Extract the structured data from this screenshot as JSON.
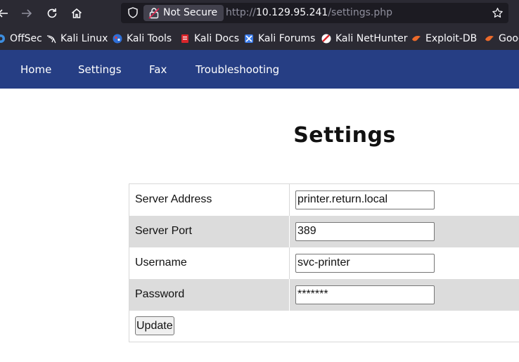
{
  "browser": {
    "not_secure_label": "Not Secure",
    "url_scheme": "http://",
    "url_host": "10.129.95.241",
    "url_path": "/settings.php",
    "bookmarks": [
      {
        "label": "OffSec",
        "icon": "offsec-icon"
      },
      {
        "label": "Kali Linux",
        "icon": "kali-dragon-icon"
      },
      {
        "label": "Kali Tools",
        "icon": "kali-tools-icon"
      },
      {
        "label": "Kali Docs",
        "icon": "kali-docs-icon"
      },
      {
        "label": "Kali Forums",
        "icon": "kali-forums-icon"
      },
      {
        "label": "Kali NetHunter",
        "icon": "kali-nethunter-icon"
      },
      {
        "label": "Exploit-DB",
        "icon": "exploit-db-icon"
      },
      {
        "label": "Goog",
        "icon": "google-hacking-icon"
      }
    ]
  },
  "nav": {
    "items": [
      "Home",
      "Settings",
      "Fax",
      "Troubleshooting"
    ],
    "background": "#263e84"
  },
  "page": {
    "title": "Settings"
  },
  "form": {
    "rows": [
      {
        "label": "Server Address",
        "value": "printer.return.local"
      },
      {
        "label": "Server Port",
        "value": "389"
      },
      {
        "label": "Username",
        "value": "svc-printer"
      },
      {
        "label": "Password",
        "value": "*******"
      }
    ],
    "submit_label": "Update"
  }
}
